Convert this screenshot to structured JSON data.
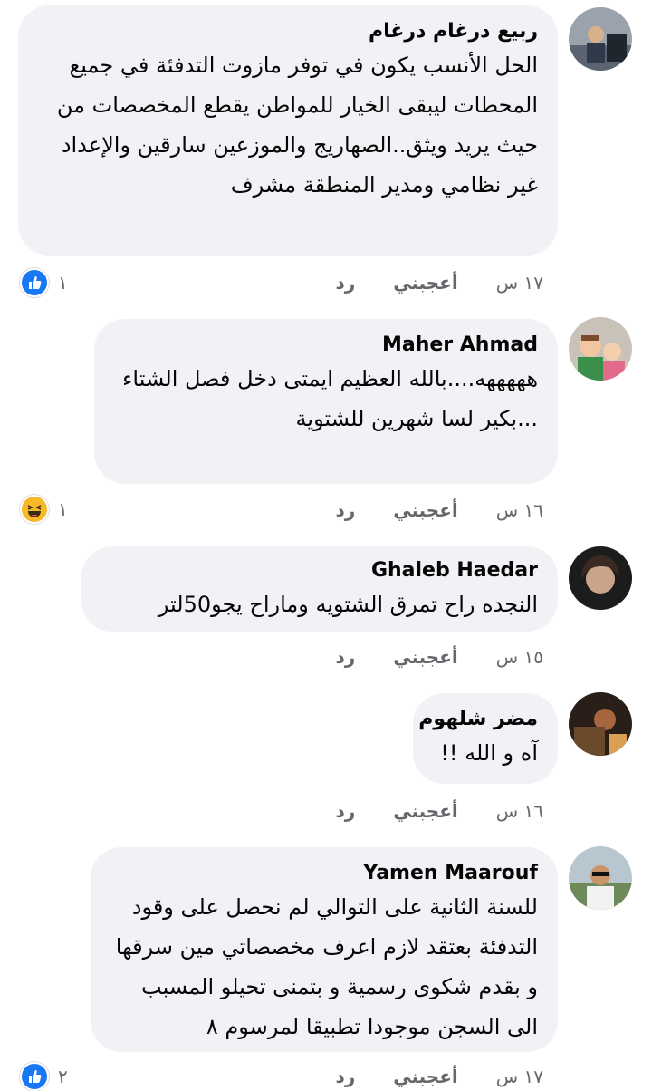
{
  "comments": [
    {
      "author": "ربيع درغام درغام",
      "text": "الحل الأنسب يكون في توفر مازوت التدفئة في جميع المحطات ليبقى الخيار للمواطن يقطع المخصصات من حيث يريد ويثق..الصهاريج والموزعين سارقين والإعداد غير نظامي ومدير المنطقة مشرف",
      "time": "١٧ س",
      "like_label": "أعجبني",
      "reply_label": "رد",
      "reaction_type": "like",
      "reaction_count": "١"
    },
    {
      "author": "Maher Ahmad",
      "text": "هههههه....بالله العظيم ايمتى دخل فصل الشتاء ...بكير لسا شهرين للشتوية",
      "time": "١٦ س",
      "like_label": "أعجبني",
      "reply_label": "رد",
      "reaction_type": "haha",
      "reaction_count": "١"
    },
    {
      "author": "Ghaleb Haedar",
      "text": "النجده راح تمرق الشتويه وماراح يجو50لتر",
      "time": "١٥ س",
      "like_label": "أعجبني",
      "reply_label": "رد"
    },
    {
      "author": "مضر شلهوم",
      "text": "آه و الله !!",
      "time": "١٦ س",
      "like_label": "أعجبني",
      "reply_label": "رد"
    },
    {
      "author": "Yamen Maarouf",
      "text": "للسنة الثانية على التوالي لم نحصل على وقود التدفئة بعتقد لازم اعرف مخصصاتي مين سرقها و بقدم شكوى رسمية و بتمنى تحيلو المسبب الى السجن موجودا تطبيقا لمرسوم ٨",
      "time": "١٧ س",
      "like_label": "أعجبني",
      "reply_label": "رد",
      "reaction_type": "like",
      "reaction_count": "٢"
    }
  ],
  "colors": {
    "bubble": "#f0f2f5",
    "meta_text": "#65676b",
    "like_blue": "#1877f2",
    "haha_yellow": "#f7b928"
  },
  "icons": {
    "like_reaction": "thumbs-up-icon",
    "haha_reaction": "laughing-face-icon"
  }
}
